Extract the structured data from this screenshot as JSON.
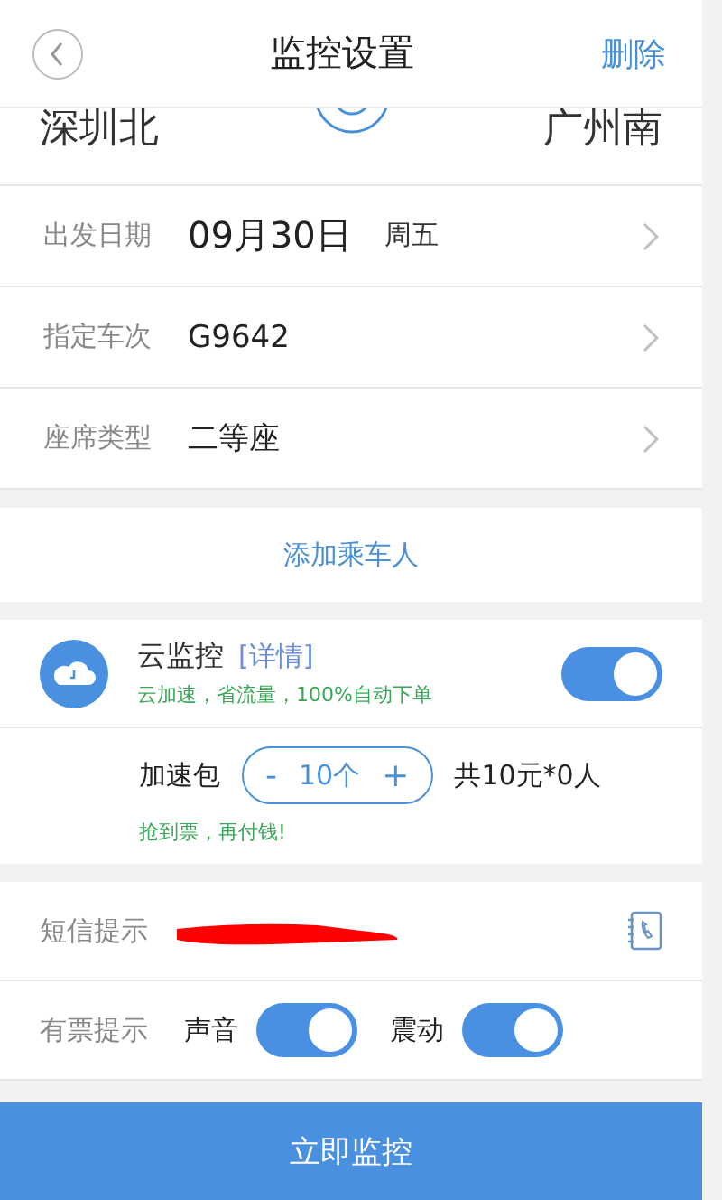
{
  "header": {
    "title": "监控设置",
    "action": "删除"
  },
  "route": {
    "from": "深圳北",
    "to": "广州南"
  },
  "details": [
    {
      "label": "出发日期",
      "value": "09月30日",
      "extra": "周五"
    },
    {
      "label": "指定车次",
      "value": "G9642"
    },
    {
      "label": "座席类型",
      "value": "二等座"
    }
  ],
  "add_passenger": "添加乘车人",
  "cloud": {
    "title": "云监控",
    "link": "[详情]",
    "subtitle": "云加速，省流量，100%自动下单",
    "on": true,
    "package_label": "加速包",
    "minus": "-",
    "count": "10个",
    "plus": "+",
    "total": "共10元*0人",
    "note": "抢到票，再付钱!"
  },
  "sms": {
    "label": "短信提示"
  },
  "alert": {
    "label": "有票提示",
    "options": [
      {
        "label": "声音",
        "on": true
      },
      {
        "label": "震动",
        "on": true
      }
    ]
  },
  "submit": "立即监控"
}
